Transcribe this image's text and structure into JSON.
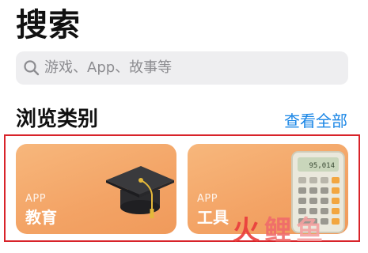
{
  "header": {
    "title": "搜索"
  },
  "search": {
    "placeholder": "游戏、App、故事等",
    "icon": "search-icon"
  },
  "section": {
    "title": "浏览类别",
    "see_all_label": "查看全部"
  },
  "categories": [
    {
      "kicker": "APP",
      "label": "教育",
      "icon": "graduation-cap-icon"
    },
    {
      "kicker": "APP",
      "label": "工具",
      "icon": "calculator-icon",
      "display_value": "95,014"
    }
  ],
  "watermark": {
    "text": "火鲤鱼"
  },
  "colors": {
    "accent": "#1a86e6",
    "card_orange": "#f3a365",
    "highlight_red": "#d8232a",
    "search_bg": "#eeeef0"
  }
}
